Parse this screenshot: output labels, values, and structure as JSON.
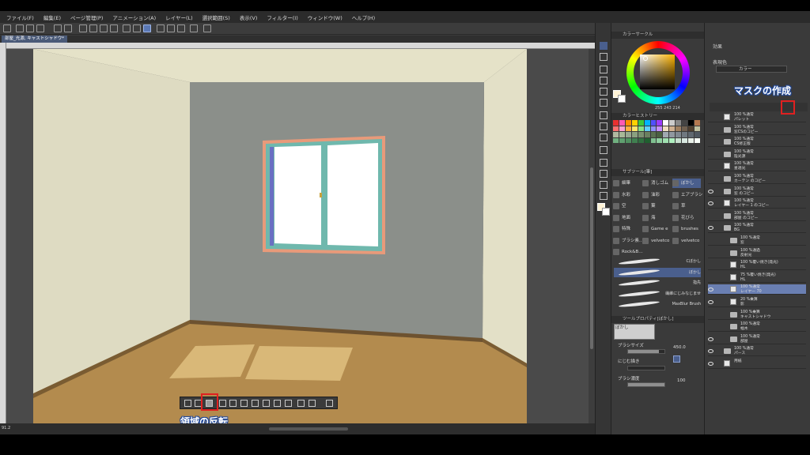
{
  "menu": {
    "items": [
      "ファイル(F)",
      "編集(E)",
      "ページ管理(P)",
      "アニメーション(A)",
      "レイヤー(L)",
      "選択範囲(S)",
      "表示(V)",
      "フィルター(I)",
      "ウィンドウ(W)",
      "ヘルプ(H)"
    ]
  },
  "document": {
    "tab_label": "部屋_光源, キャストシャドウ*"
  },
  "annotations": {
    "invert_area": "領域の反転",
    "create_mask": "マスクの作成"
  },
  "color_panel": {
    "wheel_tab": "カラーサークル",
    "history_tab": "カラーヒストリー",
    "rgb": {
      "r": "255",
      "g": "243",
      "b": "214"
    },
    "main_color": "#fff3d6",
    "history_colors": [
      "#e83030",
      "#ff5ab4",
      "#ff8c00",
      "#ffd200",
      "#3cc83c",
      "#00b4ff",
      "#5050ff",
      "#9a3cff",
      "#ffffff",
      "#cccccc",
      "#888888",
      "#444444",
      "#000000",
      "#b47850",
      "#ff7070",
      "#ffa0d0",
      "#ffb040",
      "#ffe66a",
      "#88e088",
      "#60d0ff",
      "#9090ff",
      "#c890ff",
      "#f0e0c0",
      "#d0b090",
      "#a08060",
      "#706050",
      "#504030",
      "#c0c0a0",
      "#b0b8a0",
      "#a8b898",
      "#98a890",
      "#8aa080",
      "#7a9070",
      "#6a8060",
      "#5a7050",
      "#4a6040",
      "#a0a8b0",
      "#9098a0",
      "#808890",
      "#707880",
      "#606870",
      "#505860",
      "#70b080",
      "#60a070",
      "#509060",
      "#408050",
      "#307040",
      "#206030",
      "#80c090",
      "#90d0a0",
      "#a0e0b0",
      "#b0f0c0",
      "#c8e0d0",
      "#d8e8e0",
      "#e8f0e8",
      "#f8fff8"
    ]
  },
  "subtool": {
    "tab": "サブツール[筆]",
    "items": [
      [
        "細筆",
        "消しゴム",
        "ぼかし"
      ],
      [
        "水彩",
        "油彩",
        "エアブラシ"
      ],
      [
        "空",
        "葉",
        "草"
      ],
      [
        "地面",
        "海",
        "花びら"
      ],
      [
        "特殊",
        "Game e",
        "brushes"
      ],
      [
        "ブラシ素…",
        "velvetco",
        "velvetco"
      ],
      [
        "Rock&B…",
        "",
        ""
      ]
    ],
    "brushes": [
      "Cぼかし",
      "ぼかし",
      "指先",
      "繊維にじみなじませ",
      "MaxBlur Brush"
    ]
  },
  "tool_property": {
    "tab": "ツールプロパティ[ぼかし]",
    "preset": "ぼかし",
    "brush_size_label": "ブラシサイズ",
    "brush_size_value": "450.0",
    "brush_size_fraction": 0.85,
    "blur_label": "にじむ描き",
    "brush_density_label": "ブラシ濃度",
    "brush_density_value": "100",
    "brush_density_fraction": 1.0
  },
  "layer_panel": {
    "effect_label": "効果",
    "display_color_label": "表現色",
    "display_color_value": "カラー",
    "layers": [
      {
        "line1": "100 %通常",
        "line2": "パレット",
        "kind": "layer",
        "indent": 0,
        "visible": false,
        "selected": false
      },
      {
        "line1": "100 %通常",
        "line2": "窓CSのコピー",
        "kind": "folder",
        "indent": 0,
        "visible": false,
        "selected": false
      },
      {
        "line1": "100 %通常",
        "line2": "CS修正版",
        "kind": "folder",
        "indent": 0,
        "visible": false,
        "selected": false
      },
      {
        "line1": "100 %通常",
        "line2": "陰光源",
        "kind": "folder",
        "indent": 0,
        "visible": false,
        "selected": false
      },
      {
        "line1": "100 %通常",
        "line2": "星適光",
        "kind": "layer",
        "indent": 0,
        "visible": false,
        "selected": false
      },
      {
        "line1": "100 %通常",
        "line2": "カーテン のコピー",
        "kind": "folder",
        "indent": 0,
        "visible": false,
        "selected": false
      },
      {
        "line1": "100 %通常",
        "line2": "窓 のコピー",
        "kind": "folder",
        "indent": 0,
        "visible": true,
        "selected": false
      },
      {
        "line1": "100 %通常",
        "line2": "レイヤー 1 のコピー",
        "kind": "layer",
        "indent": 0,
        "visible": true,
        "selected": false
      },
      {
        "line1": "100 %通常",
        "line2": "部屋 のコピー",
        "kind": "folder",
        "indent": 0,
        "visible": false,
        "selected": false
      },
      {
        "line1": "100 %通常",
        "line2": "BG",
        "kind": "folder",
        "indent": 0,
        "visible": true,
        "selected": false
      },
      {
        "line1": "100 %通常",
        "line2": "窓",
        "kind": "folder",
        "indent": 1,
        "visible": false,
        "selected": false
      },
      {
        "line1": "100 %通過",
        "line2": "反射光",
        "kind": "folder",
        "indent": 1,
        "visible": false,
        "selected": false
      },
      {
        "line1": "100 %覆い焼き(発光)",
        "line2": "HL",
        "kind": "layer",
        "indent": 1,
        "visible": false,
        "selected": false
      },
      {
        "line1": "75 %覆い焼き(発光)",
        "line2": "HL",
        "kind": "layer",
        "indent": 1,
        "visible": false,
        "selected": false
      },
      {
        "line1": "100 %通常",
        "line2": "レイヤー 70",
        "kind": "layer",
        "indent": 1,
        "visible": true,
        "selected": true
      },
      {
        "line1": "20 %乗算",
        "line2": "影",
        "kind": "layer",
        "indent": 1,
        "visible": true,
        "selected": false
      },
      {
        "line1": "100 %乗算",
        "line2": "キャストシャドウ",
        "kind": "folder",
        "indent": 1,
        "visible": false,
        "selected": false
      },
      {
        "line1": "100 %通常",
        "line2": "幅木",
        "kind": "folder",
        "indent": 1,
        "visible": false,
        "selected": false
      },
      {
        "line1": "100 %通常",
        "line2": "部屋",
        "kind": "folder",
        "indent": 1,
        "visible": true,
        "selected": false
      },
      {
        "line1": "100 %通常",
        "line2": "パース",
        "kind": "folder",
        "indent": 0,
        "visible": true,
        "selected": false
      },
      {
        "line1": "",
        "line2": "用紙",
        "kind": "layer",
        "indent": 0,
        "visible": true,
        "selected": false
      }
    ]
  },
  "status": {
    "zoom": "91.2"
  }
}
